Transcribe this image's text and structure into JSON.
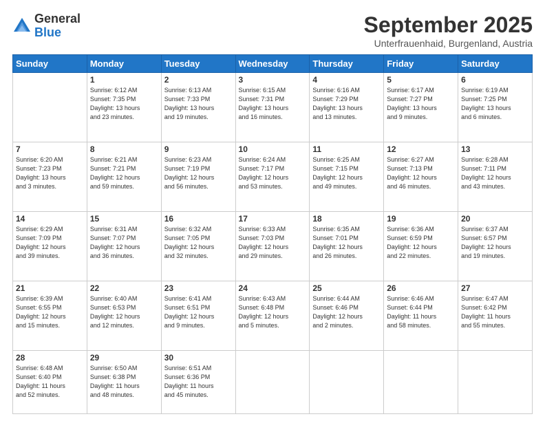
{
  "logo": {
    "general": "General",
    "blue": "Blue"
  },
  "header": {
    "month": "September 2025",
    "subtitle": "Unterfrauenhaid, Burgenland, Austria"
  },
  "days_of_week": [
    "Sunday",
    "Monday",
    "Tuesday",
    "Wednesday",
    "Thursday",
    "Friday",
    "Saturday"
  ],
  "weeks": [
    [
      {
        "day": "",
        "info": ""
      },
      {
        "day": "1",
        "info": "Sunrise: 6:12 AM\nSunset: 7:35 PM\nDaylight: 13 hours\nand 23 minutes."
      },
      {
        "day": "2",
        "info": "Sunrise: 6:13 AM\nSunset: 7:33 PM\nDaylight: 13 hours\nand 19 minutes."
      },
      {
        "day": "3",
        "info": "Sunrise: 6:15 AM\nSunset: 7:31 PM\nDaylight: 13 hours\nand 16 minutes."
      },
      {
        "day": "4",
        "info": "Sunrise: 6:16 AM\nSunset: 7:29 PM\nDaylight: 13 hours\nand 13 minutes."
      },
      {
        "day": "5",
        "info": "Sunrise: 6:17 AM\nSunset: 7:27 PM\nDaylight: 13 hours\nand 9 minutes."
      },
      {
        "day": "6",
        "info": "Sunrise: 6:19 AM\nSunset: 7:25 PM\nDaylight: 13 hours\nand 6 minutes."
      }
    ],
    [
      {
        "day": "7",
        "info": "Sunrise: 6:20 AM\nSunset: 7:23 PM\nDaylight: 13 hours\nand 3 minutes."
      },
      {
        "day": "8",
        "info": "Sunrise: 6:21 AM\nSunset: 7:21 PM\nDaylight: 12 hours\nand 59 minutes."
      },
      {
        "day": "9",
        "info": "Sunrise: 6:23 AM\nSunset: 7:19 PM\nDaylight: 12 hours\nand 56 minutes."
      },
      {
        "day": "10",
        "info": "Sunrise: 6:24 AM\nSunset: 7:17 PM\nDaylight: 12 hours\nand 53 minutes."
      },
      {
        "day": "11",
        "info": "Sunrise: 6:25 AM\nSunset: 7:15 PM\nDaylight: 12 hours\nand 49 minutes."
      },
      {
        "day": "12",
        "info": "Sunrise: 6:27 AM\nSunset: 7:13 PM\nDaylight: 12 hours\nand 46 minutes."
      },
      {
        "day": "13",
        "info": "Sunrise: 6:28 AM\nSunset: 7:11 PM\nDaylight: 12 hours\nand 43 minutes."
      }
    ],
    [
      {
        "day": "14",
        "info": "Sunrise: 6:29 AM\nSunset: 7:09 PM\nDaylight: 12 hours\nand 39 minutes."
      },
      {
        "day": "15",
        "info": "Sunrise: 6:31 AM\nSunset: 7:07 PM\nDaylight: 12 hours\nand 36 minutes."
      },
      {
        "day": "16",
        "info": "Sunrise: 6:32 AM\nSunset: 7:05 PM\nDaylight: 12 hours\nand 32 minutes."
      },
      {
        "day": "17",
        "info": "Sunrise: 6:33 AM\nSunset: 7:03 PM\nDaylight: 12 hours\nand 29 minutes."
      },
      {
        "day": "18",
        "info": "Sunrise: 6:35 AM\nSunset: 7:01 PM\nDaylight: 12 hours\nand 26 minutes."
      },
      {
        "day": "19",
        "info": "Sunrise: 6:36 AM\nSunset: 6:59 PM\nDaylight: 12 hours\nand 22 minutes."
      },
      {
        "day": "20",
        "info": "Sunrise: 6:37 AM\nSunset: 6:57 PM\nDaylight: 12 hours\nand 19 minutes."
      }
    ],
    [
      {
        "day": "21",
        "info": "Sunrise: 6:39 AM\nSunset: 6:55 PM\nDaylight: 12 hours\nand 15 minutes."
      },
      {
        "day": "22",
        "info": "Sunrise: 6:40 AM\nSunset: 6:53 PM\nDaylight: 12 hours\nand 12 minutes."
      },
      {
        "day": "23",
        "info": "Sunrise: 6:41 AM\nSunset: 6:51 PM\nDaylight: 12 hours\nand 9 minutes."
      },
      {
        "day": "24",
        "info": "Sunrise: 6:43 AM\nSunset: 6:48 PM\nDaylight: 12 hours\nand 5 minutes."
      },
      {
        "day": "25",
        "info": "Sunrise: 6:44 AM\nSunset: 6:46 PM\nDaylight: 12 hours\nand 2 minutes."
      },
      {
        "day": "26",
        "info": "Sunrise: 6:46 AM\nSunset: 6:44 PM\nDaylight: 11 hours\nand 58 minutes."
      },
      {
        "day": "27",
        "info": "Sunrise: 6:47 AM\nSunset: 6:42 PM\nDaylight: 11 hours\nand 55 minutes."
      }
    ],
    [
      {
        "day": "28",
        "info": "Sunrise: 6:48 AM\nSunset: 6:40 PM\nDaylight: 11 hours\nand 52 minutes."
      },
      {
        "day": "29",
        "info": "Sunrise: 6:50 AM\nSunset: 6:38 PM\nDaylight: 11 hours\nand 48 minutes."
      },
      {
        "day": "30",
        "info": "Sunrise: 6:51 AM\nSunset: 6:36 PM\nDaylight: 11 hours\nand 45 minutes."
      },
      {
        "day": "",
        "info": ""
      },
      {
        "day": "",
        "info": ""
      },
      {
        "day": "",
        "info": ""
      },
      {
        "day": "",
        "info": ""
      }
    ]
  ]
}
